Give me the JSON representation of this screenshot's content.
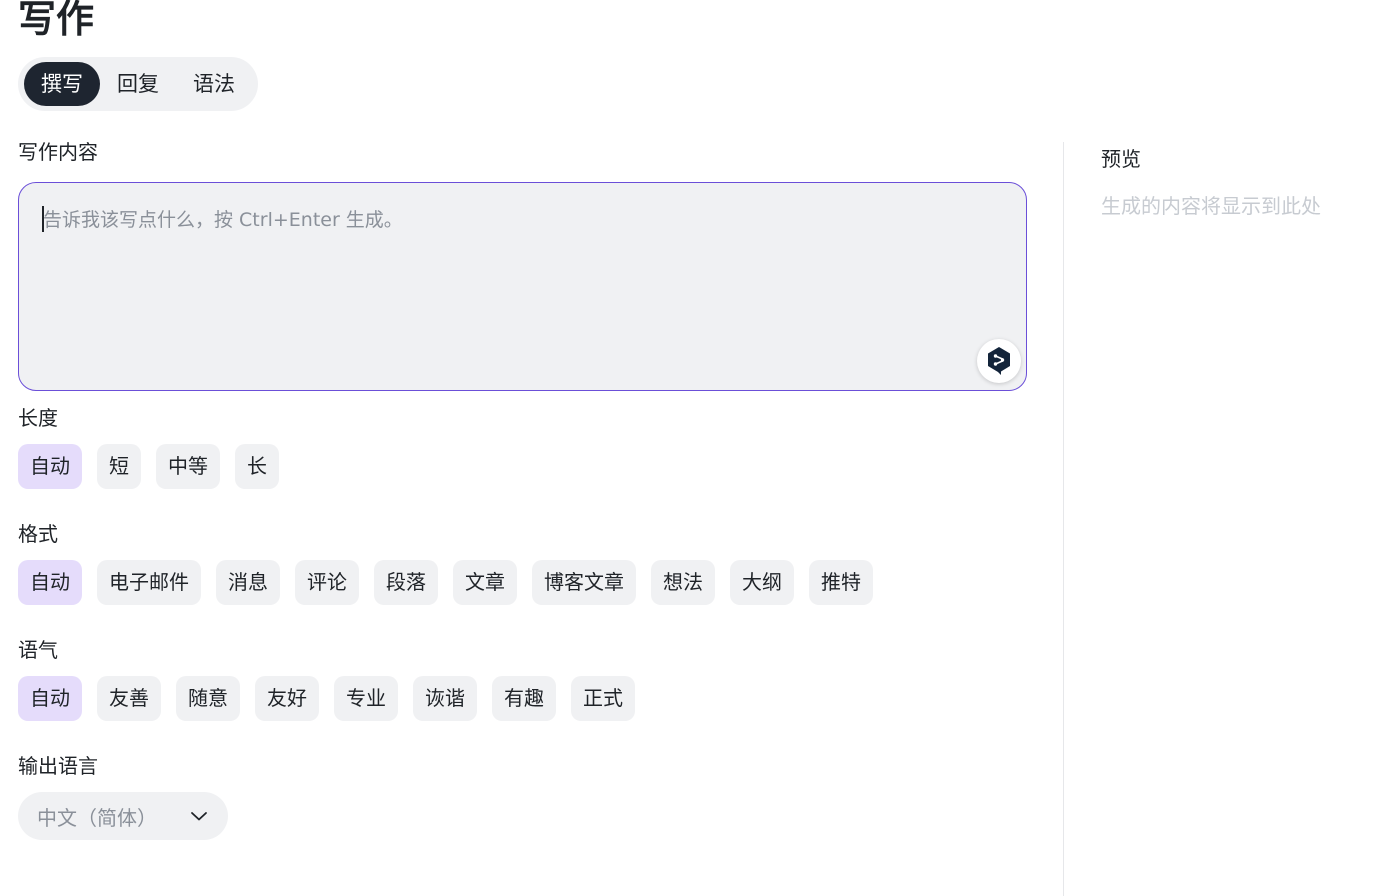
{
  "page_title": "写作",
  "mode_tabs": [
    {
      "label": "撰写",
      "active": true
    },
    {
      "label": "回复",
      "active": false
    },
    {
      "label": "语法",
      "active": false
    }
  ],
  "content": {
    "label": "写作内容",
    "placeholder": "告诉我该写点什么，按 Ctrl+Enter 生成。",
    "value": ""
  },
  "length": {
    "label": "长度",
    "options": [
      "自动",
      "短",
      "中等",
      "长"
    ],
    "selected": "自动"
  },
  "format": {
    "label": "格式",
    "options": [
      "自动",
      "电子邮件",
      "消息",
      "评论",
      "段落",
      "文章",
      "博客文章",
      "想法",
      "大纲",
      "推特"
    ],
    "selected": "自动"
  },
  "tone": {
    "label": "语气",
    "options": [
      "自动",
      "友善",
      "随意",
      "友好",
      "专业",
      "诙谐",
      "有趣",
      "正式"
    ],
    "selected": "自动"
  },
  "output_language": {
    "label": "输出语言",
    "value": "中文（简体）"
  },
  "preview": {
    "title": "预览",
    "placeholder": "生成的内容将显示到此处"
  },
  "colors": {
    "accent": "#6b4fd8",
    "selected_chip": "#e5dcfb",
    "active_tab": "#1e2530",
    "chip_bg": "#f0f1f3"
  },
  "icons": {
    "send": "deepl-send-icon",
    "dropdown": "chevron-down-icon"
  }
}
